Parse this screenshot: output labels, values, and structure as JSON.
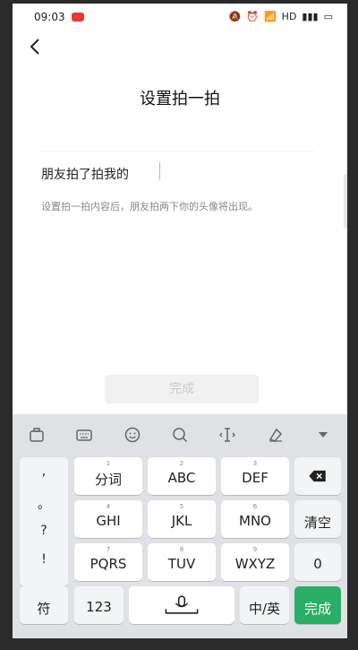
{
  "status": {
    "time": "09:03",
    "network": "HD"
  },
  "page": {
    "title": "设置拍一拍",
    "input_text": "朋友拍了拍我的",
    "hint": "设置拍一拍内容后，朋友拍两下你的头像将出现。",
    "done_label": "完成"
  },
  "keyboard": {
    "toolbar_icons": [
      "toolbox-icon",
      "keyboard-icon",
      "emoji-icon",
      "search-icon",
      "cursor-move-icon",
      "clean-icon",
      "collapse-icon"
    ],
    "punct": [
      ",",
      "。",
      "?",
      "!"
    ],
    "row1": [
      {
        "sub": "1",
        "label": "分词"
      },
      {
        "sub": "2",
        "label": "ABC"
      },
      {
        "sub": "3",
        "label": "DEF"
      }
    ],
    "row2": [
      {
        "sub": "4",
        "label": "GHI"
      },
      {
        "sub": "5",
        "label": "JKL"
      },
      {
        "sub": "6",
        "label": "MNO"
      }
    ],
    "row3": [
      {
        "sub": "7",
        "label": "PQRS"
      },
      {
        "sub": "8",
        "label": "TUV"
      },
      {
        "sub": "9",
        "label": "WXYZ"
      }
    ],
    "clear_label": "清空",
    "zero_label": "0",
    "symbol_label": "符",
    "num_label": "123",
    "lang_label": "中/英",
    "send_label": "完成"
  }
}
